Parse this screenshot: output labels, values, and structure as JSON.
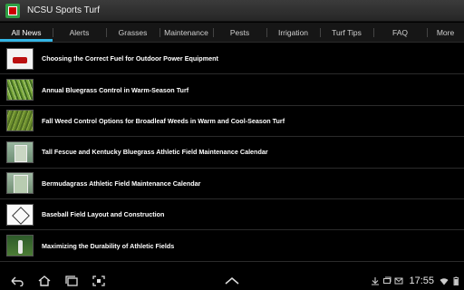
{
  "app": {
    "title": "NCSU Sports Turf"
  },
  "tabs": [
    {
      "label": "All News",
      "active": true
    },
    {
      "label": "Alerts"
    },
    {
      "label": "Grasses"
    },
    {
      "label": "Maintenance"
    },
    {
      "label": "Pests"
    },
    {
      "label": "Irrigation"
    },
    {
      "label": "Turf Tips"
    },
    {
      "label": "FAQ"
    },
    {
      "label": "More"
    }
  ],
  "articles": [
    {
      "title": "Choosing the Correct Fuel for Outdoor Power Equipment",
      "thumb": "mower-image"
    },
    {
      "title": "Annual Bluegrass Control in Warm-Season Turf",
      "thumb": "grass-image"
    },
    {
      "title": "Fall Weed Control Options for Broadleaf Weeds in Warm and Cool-Season Turf",
      "thumb": "grass-image"
    },
    {
      "title": "Tall Fescue and Kentucky Bluegrass Athletic Field Maintenance Calendar",
      "thumb": "aerial-field-image"
    },
    {
      "title": "Bermudagrass Athletic Field Maintenance Calendar",
      "thumb": "aerial-field-image"
    },
    {
      "title": "Baseball Field Layout and Construction",
      "thumb": "field-diagram-image"
    },
    {
      "title": "Maximizing the Durability of Athletic Fields",
      "thumb": "athlete-image"
    }
  ],
  "statusbar": {
    "time": "17:55"
  },
  "colors": {
    "accent": "#33b5e5",
    "background": "#000000",
    "titlebar": "#2e2e2e"
  }
}
